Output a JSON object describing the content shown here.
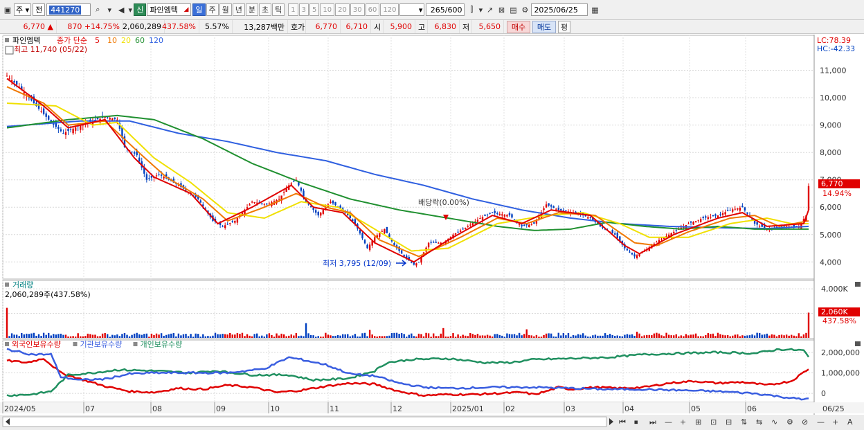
{
  "toolbar": {
    "type_sel": "주",
    "prefix": "전",
    "code": "441270",
    "badge": "신",
    "name": "파인엠텍",
    "periods": [
      "일",
      "주",
      "월",
      "년",
      "분",
      "초",
      "틱"
    ],
    "active_period": "일",
    "nums": [
      "1",
      "3",
      "5",
      "10",
      "20",
      "30",
      "60",
      "120"
    ],
    "count": "265",
    "count_total": "/600",
    "date": "2025/06/25"
  },
  "quote": {
    "price": "6,770",
    "change": "870",
    "change_pct": "+14.75%",
    "volume": "2,060,289",
    "vol_ratio": "437.58%",
    "turnover": "5.57%",
    "amount": "13,287백만",
    "hoga_label": "호가",
    "ask": "6,770",
    "bid": "6,710",
    "open_label": "시",
    "open": "5,900",
    "high_label": "고",
    "high": "6,830",
    "low_label": "저",
    "low": "5,650",
    "buy": "매수",
    "sell": "매도",
    "eval": "평"
  },
  "legend": {
    "name": "파인엠텍",
    "close_label": "종가 단순",
    "ma_periods": [
      "5",
      "10",
      "20",
      "60",
      "120"
    ],
    "ma_colors": [
      "#e00000",
      "#f07800",
      "#f0e000",
      "#209030",
      "#3060e0"
    ],
    "high_note": "최고 11,740 (05/22)",
    "low_note": "최저 3,795 (12/09)",
    "div_note": "배당락(0.00%)",
    "lc": "LC:78.39",
    "hc": "HC:-42.33",
    "last_price": "6,770",
    "last_pct": "14.94%"
  },
  "volume_panel": {
    "title": "거래량",
    "value": "2,060,289주(437.58%)",
    "last_label": "2,060K",
    "last_pct": "437.58%"
  },
  "holdings_panel": {
    "titles": [
      "외국인보유수량",
      "기관보유수량",
      "개인보유수량"
    ]
  },
  "chart_data": [
    {
      "type": "candlestick",
      "name": "price",
      "x_labels": [
        "2024/05",
        "07",
        "08",
        "09",
        "10",
        "11",
        "12",
        "2025/01",
        "02",
        "03",
        "04",
        "05",
        "06",
        "06/25"
      ],
      "yticks": [
        4000,
        5000,
        6000,
        7000,
        8000,
        9000,
        10000,
        11000
      ],
      "ytick_labels": [
        "4,000",
        "5,000",
        "6,000",
        "7,000",
        "8,000",
        "9,000",
        "10,000",
        "11,000"
      ],
      "ylim": [
        3400,
        11800
      ],
      "close_keypoints": [
        [
          0,
          10800
        ],
        [
          5,
          10400
        ],
        [
          10,
          9900
        ],
        [
          18,
          9100
        ],
        [
          23,
          8700
        ],
        [
          30,
          9000
        ],
        [
          40,
          9300
        ],
        [
          45,
          9200
        ],
        [
          48,
          8200
        ],
        [
          53,
          7900
        ],
        [
          57,
          7000
        ],
        [
          62,
          7200
        ],
        [
          70,
          6800
        ],
        [
          78,
          6300
        ],
        [
          84,
          5500
        ],
        [
          88,
          5300
        ],
        [
          93,
          5500
        ],
        [
          100,
          6200
        ],
        [
          106,
          6100
        ],
        [
          111,
          6300
        ],
        [
          115,
          6800
        ],
        [
          118,
          7000
        ],
        [
          122,
          6200
        ],
        [
          127,
          5700
        ],
        [
          132,
          6200
        ],
        [
          137,
          5900
        ],
        [
          142,
          5400
        ],
        [
          147,
          4500
        ],
        [
          150,
          4900
        ],
        [
          154,
          5200
        ],
        [
          158,
          4600
        ],
        [
          162,
          4200
        ],
        [
          166,
          3900
        ],
        [
          168,
          4000
        ],
        [
          172,
          4700
        ],
        [
          178,
          4700
        ],
        [
          182,
          5000
        ],
        [
          188,
          5300
        ],
        [
          193,
          5600
        ],
        [
          198,
          5800
        ],
        [
          205,
          5700
        ],
        [
          210,
          5300
        ],
        [
          215,
          5400
        ],
        [
          220,
          6100
        ],
        [
          225,
          5900
        ],
        [
          232,
          5800
        ],
        [
          238,
          5600
        ],
        [
          242,
          5300
        ],
        [
          248,
          5000
        ],
        [
          252,
          4500
        ],
        [
          256,
          4200
        ],
        [
          260,
          4400
        ],
        [
          266,
          4800
        ],
        [
          272,
          5100
        ],
        [
          278,
          5400
        ],
        [
          284,
          5600
        ],
        [
          290,
          5700
        ],
        [
          295,
          5900
        ],
        [
          300,
          6000
        ],
        [
          305,
          5400
        ],
        [
          310,
          5200
        ],
        [
          318,
          5300
        ],
        [
          323,
          5300
        ],
        [
          326,
          5700
        ],
        [
          327,
          6770
        ]
      ],
      "ma5": [
        [
          0,
          10700
        ],
        [
          15,
          9700
        ],
        [
          25,
          8900
        ],
        [
          40,
          9200
        ],
        [
          52,
          7800
        ],
        [
          60,
          7100
        ],
        [
          75,
          6500
        ],
        [
          86,
          5400
        ],
        [
          100,
          6000
        ],
        [
          116,
          6800
        ],
        [
          125,
          6000
        ],
        [
          137,
          5800
        ],
        [
          150,
          4700
        ],
        [
          166,
          4000
        ],
        [
          180,
          4800
        ],
        [
          198,
          5700
        ],
        [
          210,
          5400
        ],
        [
          222,
          5900
        ],
        [
          238,
          5700
        ],
        [
          252,
          4600
        ],
        [
          258,
          4300
        ],
        [
          272,
          5000
        ],
        [
          290,
          5600
        ],
        [
          300,
          5800
        ],
        [
          310,
          5300
        ],
        [
          325,
          5400
        ],
        [
          327,
          5900
        ]
      ],
      "ma10": [
        [
          0,
          10400
        ],
        [
          15,
          9800
        ],
        [
          25,
          9000
        ],
        [
          40,
          9150
        ],
        [
          55,
          7900
        ],
        [
          65,
          7100
        ],
        [
          80,
          6300
        ],
        [
          90,
          5500
        ],
        [
          105,
          6000
        ],
        [
          118,
          6500
        ],
        [
          130,
          6000
        ],
        [
          140,
          5800
        ],
        [
          152,
          4800
        ],
        [
          168,
          4200
        ],
        [
          185,
          4900
        ],
        [
          200,
          5600
        ],
        [
          212,
          5400
        ],
        [
          225,
          5800
        ],
        [
          240,
          5700
        ],
        [
          256,
          4700
        ],
        [
          265,
          4600
        ],
        [
          278,
          5100
        ],
        [
          295,
          5600
        ],
        [
          305,
          5700
        ],
        [
          315,
          5300
        ],
        [
          327,
          5500
        ]
      ],
      "ma20": [
        [
          0,
          9800
        ],
        [
          20,
          9700
        ],
        [
          35,
          9000
        ],
        [
          45,
          9100
        ],
        [
          60,
          7800
        ],
        [
          75,
          6900
        ],
        [
          90,
          5800
        ],
        [
          105,
          5600
        ],
        [
          120,
          6200
        ],
        [
          135,
          6000
        ],
        [
          150,
          5200
        ],
        [
          165,
          4400
        ],
        [
          180,
          4500
        ],
        [
          200,
          5400
        ],
        [
          220,
          5700
        ],
        [
          235,
          5800
        ],
        [
          250,
          5400
        ],
        [
          262,
          4900
        ],
        [
          278,
          4900
        ],
        [
          295,
          5400
        ],
        [
          310,
          5600
        ],
        [
          320,
          5400
        ],
        [
          327,
          5400
        ]
      ],
      "ma60": [
        [
          0,
          8900
        ],
        [
          25,
          9200
        ],
        [
          45,
          9350
        ],
        [
          60,
          9200
        ],
        [
          80,
          8500
        ],
        [
          100,
          7600
        ],
        [
          120,
          6900
        ],
        [
          140,
          6300
        ],
        [
          160,
          5900
        ],
        [
          180,
          5600
        ],
        [
          200,
          5300
        ],
        [
          215,
          5150
        ],
        [
          230,
          5200
        ],
        [
          245,
          5450
        ],
        [
          260,
          5300
        ],
        [
          275,
          5200
        ],
        [
          290,
          5300
        ],
        [
          305,
          5200
        ],
        [
          327,
          5200
        ]
      ],
      "ma120": [
        [
          0,
          8950
        ],
        [
          30,
          9150
        ],
        [
          50,
          9150
        ],
        [
          70,
          8700
        ],
        [
          90,
          8400
        ],
        [
          110,
          8000
        ],
        [
          130,
          7700
        ],
        [
          150,
          7200
        ],
        [
          170,
          6800
        ],
        [
          190,
          6300
        ],
        [
          210,
          5900
        ],
        [
          230,
          5600
        ],
        [
          250,
          5400
        ],
        [
          270,
          5300
        ],
        [
          290,
          5250
        ],
        [
          310,
          5220
        ],
        [
          327,
          5300
        ]
      ]
    },
    {
      "type": "bar",
      "name": "volume",
      "yticks": [
        4000,
        2000
      ],
      "ytick_labels": [
        "4,000K"
      ],
      "ylim": [
        0,
        4400
      ],
      "spikes": [
        [
          0,
          2450
        ],
        [
          122,
          1200
        ],
        [
          148,
          650
        ],
        [
          178,
          800
        ],
        [
          212,
          700
        ],
        [
          257,
          500
        ],
        [
          327,
          2060
        ]
      ],
      "baseline": 300
    },
    {
      "type": "line",
      "name": "holdings",
      "yticks": [
        0,
        1000000,
        2000000
      ],
      "ytick_labels": [
        "0",
        "1,000,000",
        "2,000,000"
      ],
      "ylim": [
        -400000,
        2500000
      ],
      "series": [
        {
          "name": "외국인보유수량",
          "color": "#e00000",
          "points": [
            [
              0,
              1600000
            ],
            [
              8,
              1500000
            ],
            [
              15,
              1700000
            ],
            [
              22,
              1000000
            ],
            [
              30,
              700000
            ],
            [
              40,
              350000
            ],
            [
              50,
              100000
            ],
            [
              60,
              50000
            ],
            [
              70,
              250000
            ],
            [
              80,
              200000
            ],
            [
              90,
              400000
            ],
            [
              100,
              300000
            ],
            [
              110,
              50000
            ],
            [
              120,
              150000
            ],
            [
              130,
              350000
            ],
            [
              140,
              500000
            ],
            [
              150,
              450000
            ],
            [
              160,
              100000
            ],
            [
              170,
              -100000
            ],
            [
              180,
              -50000
            ],
            [
              190,
              -50000
            ],
            [
              200,
              0
            ],
            [
              210,
              50000
            ],
            [
              215,
              -50000
            ],
            [
              220,
              100000
            ],
            [
              225,
              300000
            ],
            [
              230,
              200000
            ],
            [
              240,
              300000
            ],
            [
              250,
              250000
            ],
            [
              260,
              300000
            ],
            [
              270,
              500000
            ],
            [
              280,
              600000
            ],
            [
              290,
              500000
            ],
            [
              300,
              550000
            ],
            [
              310,
              400000
            ],
            [
              320,
              600000
            ],
            [
              327,
              1200000
            ]
          ]
        },
        {
          "name": "기관보유수량",
          "color": "#209060",
          "points": [
            [
              0,
              -100000
            ],
            [
              10,
              -50000
            ],
            [
              18,
              100000
            ],
            [
              25,
              900000
            ],
            [
              35,
              1000000
            ],
            [
              45,
              1150000
            ],
            [
              60,
              1100000
            ],
            [
              75,
              1000000
            ],
            [
              85,
              1100000
            ],
            [
              100,
              900000
            ],
            [
              115,
              900000
            ],
            [
              125,
              650000
            ],
            [
              135,
              700000
            ],
            [
              140,
              750000
            ],
            [
              150,
              1100000
            ],
            [
              155,
              1500000
            ],
            [
              165,
              1650000
            ],
            [
              180,
              1700000
            ],
            [
              195,
              1500000
            ],
            [
              205,
              1500000
            ],
            [
              215,
              1650000
            ],
            [
              230,
              1700000
            ],
            [
              245,
              1750000
            ],
            [
              260,
              1900000
            ],
            [
              275,
              1950000
            ],
            [
              290,
              2000000
            ],
            [
              305,
              1950000
            ],
            [
              315,
              2150000
            ],
            [
              325,
              2100000
            ],
            [
              327,
              1750000
            ]
          ]
        },
        {
          "name": "개인보유수량",
          "color": "#3a5ee0",
          "points": [
            [
              0,
              2150000
            ],
            [
              10,
              1900000
            ],
            [
              18,
              1900000
            ],
            [
              22,
              800000
            ],
            [
              30,
              650000
            ],
            [
              40,
              700000
            ],
            [
              50,
              950000
            ],
            [
              60,
              1000000
            ],
            [
              75,
              1000000
            ],
            [
              90,
              1000000
            ],
            [
              105,
              1200000
            ],
            [
              115,
              1750000
            ],
            [
              120,
              1650000
            ],
            [
              130,
              1400000
            ],
            [
              140,
              950000
            ],
            [
              150,
              850000
            ],
            [
              160,
              500000
            ],
            [
              170,
              300000
            ],
            [
              180,
              250000
            ],
            [
              200,
              300000
            ],
            [
              215,
              300000
            ],
            [
              230,
              250000
            ],
            [
              245,
              200000
            ],
            [
              260,
              200000
            ],
            [
              275,
              150000
            ],
            [
              290,
              100000
            ],
            [
              305,
              0
            ],
            [
              315,
              -150000
            ],
            [
              325,
              -300000
            ],
            [
              327,
              -200000
            ]
          ]
        }
      ]
    }
  ]
}
